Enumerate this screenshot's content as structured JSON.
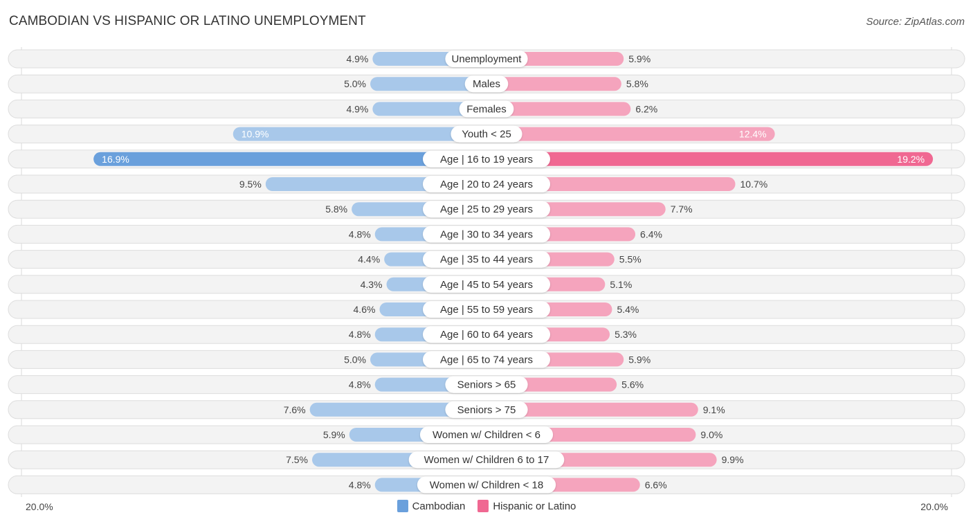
{
  "header": {
    "title": "CAMBODIAN VS HISPANIC OR LATINO UNEMPLOYMENT",
    "source": "Source: ZipAtlas.com"
  },
  "colors": {
    "cambodian": "#a8c8ea",
    "cambodian_highlight": "#6aa0dc",
    "hispanic": "#f5a4bd",
    "hispanic_highlight": "#f06892",
    "row_bg": "#f3f3f3",
    "row_border": "#dddddd"
  },
  "axis": {
    "left_label": "20.0%",
    "right_label": "20.0%"
  },
  "legend": [
    {
      "label": "Cambodian",
      "color": "#6aa0dc"
    },
    {
      "label": "Hispanic or Latino",
      "color": "#f06892"
    }
  ],
  "chart_data": {
    "type": "bar",
    "orientation": "diverging-horizontal",
    "title": "CAMBODIAN VS HISPANIC OR LATINO UNEMPLOYMENT",
    "xlabel": "",
    "ylabel": "",
    "xlim": [
      -20,
      20
    ],
    "unit": "%",
    "legend_position": "bottom-center",
    "grid": false,
    "categories": [
      "Unemployment",
      "Males",
      "Females",
      "Youth < 25",
      "Age | 16 to 19 years",
      "Age | 20 to 24 years",
      "Age | 25 to 29 years",
      "Age | 30 to 34 years",
      "Age | 35 to 44 years",
      "Age | 45 to 54 years",
      "Age | 55 to 59 years",
      "Age | 60 to 64 years",
      "Age | 65 to 74 years",
      "Seniors > 65",
      "Seniors > 75",
      "Women w/ Children < 6",
      "Women w/ Children 6 to 17",
      "Women w/ Children < 18"
    ],
    "series": [
      {
        "name": "Cambodian",
        "side": "left",
        "values": [
          4.9,
          5.0,
          4.9,
          10.9,
          16.9,
          9.5,
          5.8,
          4.8,
          4.4,
          4.3,
          4.6,
          4.8,
          5.0,
          4.8,
          7.6,
          5.9,
          7.5,
          4.8
        ],
        "labels": [
          "4.9%",
          "5.0%",
          "4.9%",
          "10.9%",
          "16.9%",
          "9.5%",
          "5.8%",
          "4.8%",
          "4.4%",
          "4.3%",
          "4.6%",
          "4.8%",
          "5.0%",
          "4.8%",
          "7.6%",
          "5.9%",
          "7.5%",
          "4.8%"
        ]
      },
      {
        "name": "Hispanic or Latino",
        "side": "right",
        "values": [
          5.9,
          5.8,
          6.2,
          12.4,
          19.2,
          10.7,
          7.7,
          6.4,
          5.5,
          5.1,
          5.4,
          5.3,
          5.9,
          5.6,
          9.1,
          9.0,
          9.9,
          6.6
        ],
        "labels": [
          "5.9%",
          "5.8%",
          "6.2%",
          "12.4%",
          "19.2%",
          "10.7%",
          "7.7%",
          "6.4%",
          "5.5%",
          "5.1%",
          "5.4%",
          "5.3%",
          "5.9%",
          "5.6%",
          "9.1%",
          "9.0%",
          "9.9%",
          "6.6%"
        ]
      }
    ]
  }
}
